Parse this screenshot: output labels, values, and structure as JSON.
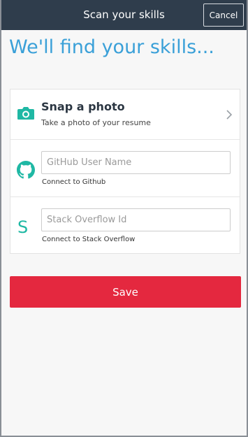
{
  "header": {
    "title": "Scan your skills",
    "cancel_label": "Cancel"
  },
  "page_title": "We'll find your skills...",
  "snap": {
    "title": "Snap a photo",
    "subtitle": "Take a photo of your resume"
  },
  "github": {
    "placeholder": "GitHub User Name",
    "value": "",
    "hint": "Connect to Github"
  },
  "stackoverflow": {
    "icon_letter": "S",
    "placeholder": "Stack Overflow Id",
    "value": "",
    "hint": "Connect to Stack Overflow"
  },
  "save_label": "Save",
  "colors": {
    "header_bg": "#2f3d4c",
    "title_blue": "#3aa0d8",
    "accent_teal": "#1fb8a4",
    "save_red": "#e4283f"
  },
  "icons": {
    "snap": "camera-icon",
    "snap_arrow": "chevron-right-icon",
    "github": "github-icon"
  }
}
